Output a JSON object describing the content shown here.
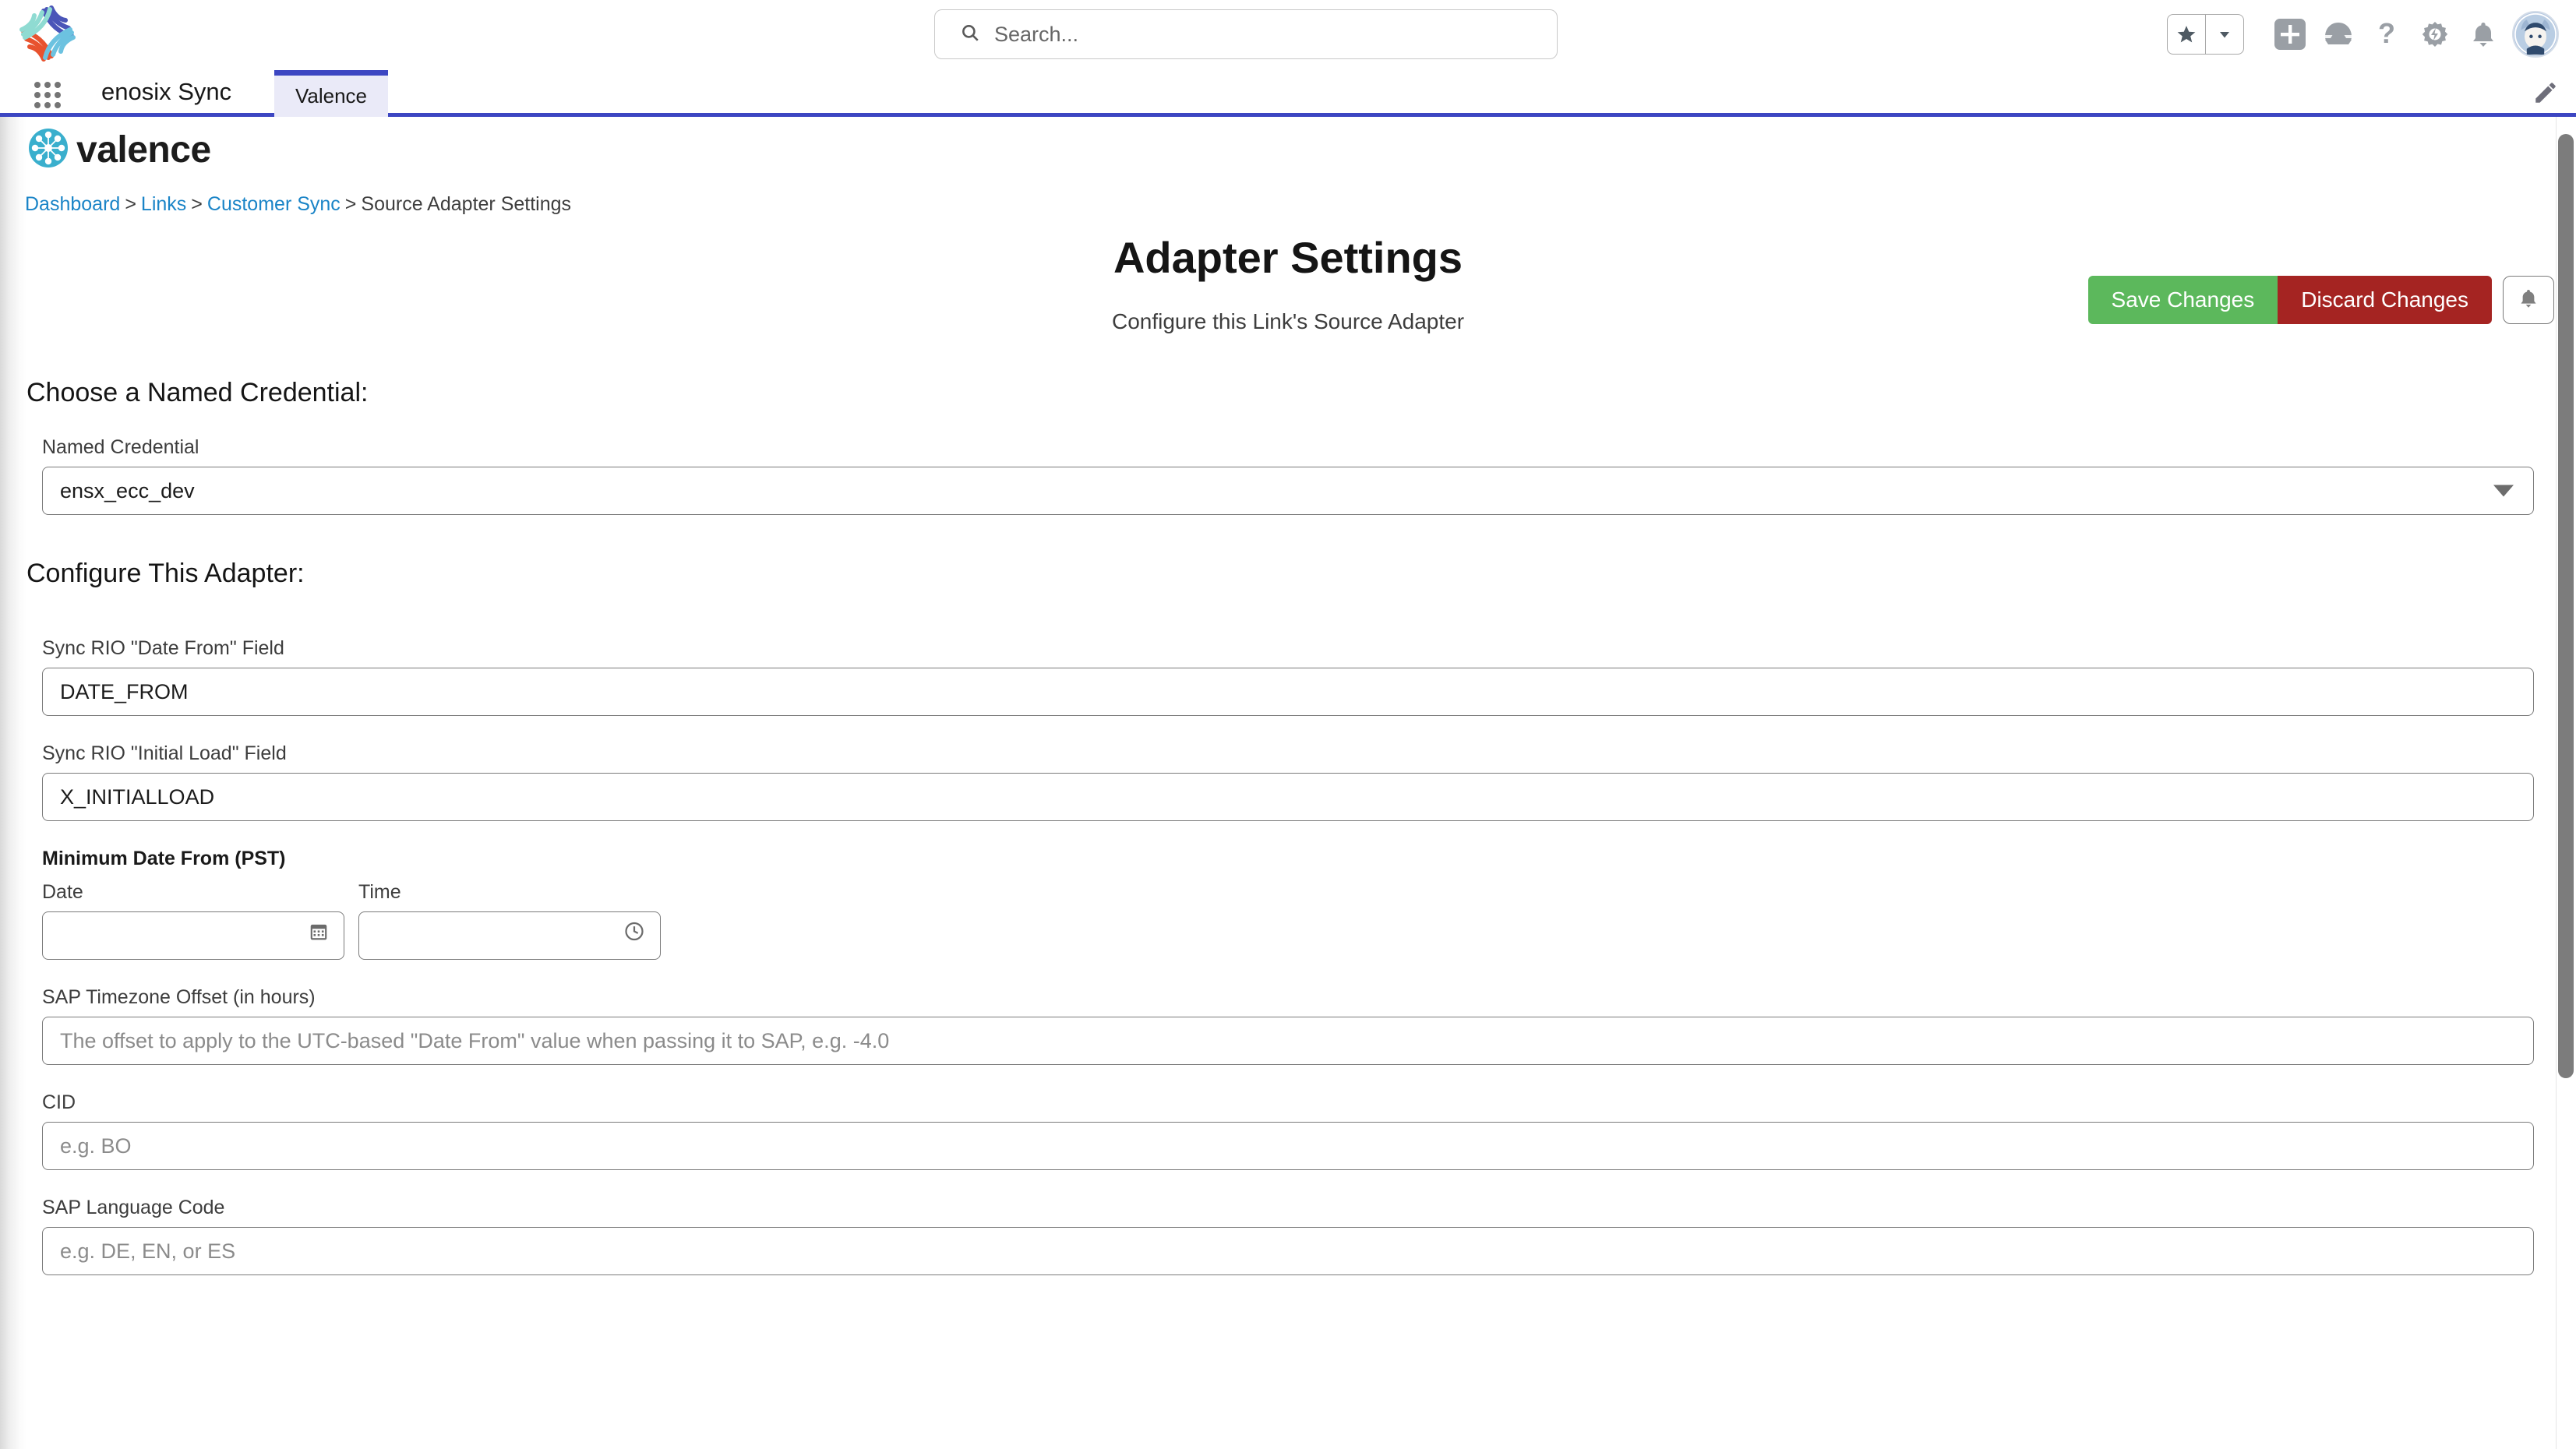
{
  "colors": {
    "brand_blue": "#3c46c2",
    "valence_teal": "#3aafcd",
    "save_green": "#5cb85c",
    "discard_red": "#a52422",
    "link_blue": "#1a84c7"
  },
  "global_header": {
    "search": {
      "placeholder": "Search...",
      "value": "",
      "icon": "search-icon"
    },
    "icons": [
      {
        "name": "favorites-star-icon",
        "glyph": "★"
      },
      {
        "name": "favorites-dropdown-icon",
        "glyph": "▼"
      },
      {
        "name": "global-actions-plus-icon",
        "glyph": "+"
      },
      {
        "name": "app-launcher-icon",
        "glyph": "⛰"
      },
      {
        "name": "help-icon",
        "glyph": "?"
      },
      {
        "name": "setup-gear-icon",
        "glyph": "⚙"
      },
      {
        "name": "notifications-bell-icon",
        "glyph": "🔔"
      },
      {
        "name": "user-avatar",
        "glyph": ""
      }
    ],
    "logo_name": "enosix-logo"
  },
  "app_nav": {
    "app_launcher_label": "app-launcher-waffle",
    "app_name": "enosix Sync",
    "tabs": [
      {
        "label": "Valence",
        "active": true
      }
    ],
    "edit_icon": "pencil-icon"
  },
  "valence": {
    "brand_name": "valence",
    "brand_icon": "valence-logo-icon",
    "breadcrumb": [
      {
        "label": "Dashboard",
        "link": true
      },
      {
        "label": "Links",
        "link": true
      },
      {
        "label": "Customer Sync",
        "link": true
      },
      {
        "label": "Source Adapter Settings",
        "link": false
      }
    ],
    "breadcrumb_separator": ">",
    "actions": {
      "save_label": "Save Changes",
      "discard_label": "Discard Changes",
      "bell_icon": "notifications-bell-icon"
    }
  },
  "main": {
    "title": "Adapter Settings",
    "subtitle": "Configure this Link's Source Adapter",
    "sections": [
      {
        "heading": "Choose a Named Credential:",
        "fields": [
          {
            "label": "Named Credential",
            "type": "select",
            "value": "ensx_ecc_dev",
            "placeholder": "",
            "options": [
              "ensx_ecc_dev"
            ]
          }
        ]
      },
      {
        "heading": "Configure This Adapter:",
        "fields": [
          {
            "label": "Sync RIO \"Date From\" Field",
            "type": "text",
            "value": "DATE_FROM",
            "placeholder": ""
          },
          {
            "label": "Sync RIO \"Initial Load\" Field",
            "type": "text",
            "value": "X_INITIALLOAD",
            "placeholder": ""
          },
          {
            "label": "Minimum Date From (PST)",
            "type": "datetime",
            "bold": true,
            "date": {
              "label": "Date",
              "value": "",
              "placeholder": "",
              "icon": "calendar-icon"
            },
            "time": {
              "label": "Time",
              "value": "",
              "placeholder": "",
              "icon": "clock-icon"
            }
          },
          {
            "label": "SAP Timezone Offset (in hours)",
            "type": "text",
            "value": "",
            "placeholder": "The offset to apply to the UTC-based \"Date From\" value when passing it to SAP, e.g. -4.0"
          },
          {
            "label": "CID",
            "type": "text",
            "value": "",
            "placeholder": "e.g. BO"
          },
          {
            "label": "SAP Language Code",
            "type": "text",
            "value": "",
            "placeholder": "e.g. DE, EN, or ES"
          }
        ]
      }
    ]
  }
}
